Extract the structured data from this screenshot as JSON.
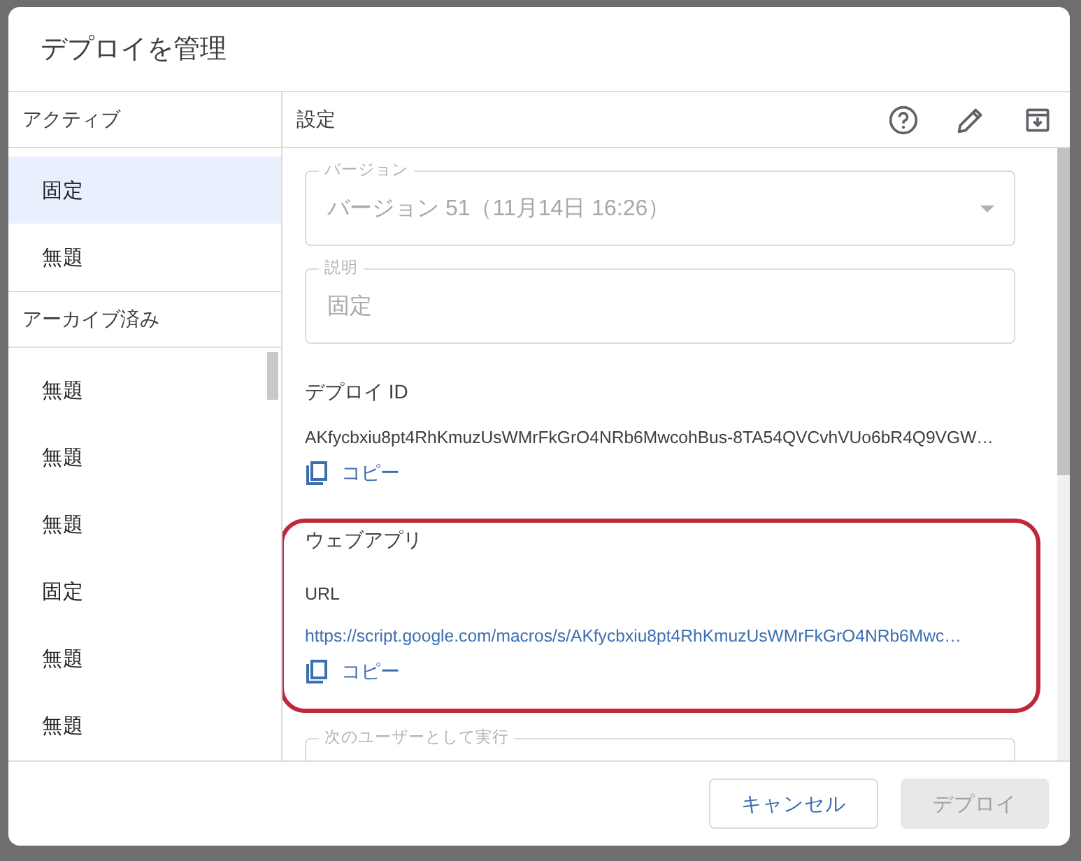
{
  "dialog": {
    "title": "デプロイを管理"
  },
  "sidebar": {
    "sections": [
      {
        "heading": "アクティブ",
        "items": [
          {
            "label": "固定",
            "selected": true
          },
          {
            "label": "無題",
            "selected": false
          }
        ]
      },
      {
        "heading": "アーカイブ済み",
        "items": [
          {
            "label": "無題",
            "selected": false
          },
          {
            "label": "無題",
            "selected": false
          },
          {
            "label": "無題",
            "selected": false
          },
          {
            "label": "固定",
            "selected": false
          },
          {
            "label": "無題",
            "selected": false
          },
          {
            "label": "無題",
            "selected": false
          }
        ]
      }
    ]
  },
  "settings": {
    "heading": "設定",
    "version": {
      "label": "バージョン",
      "value": "バージョン 51（11月14日 16:26）",
      "disabled": true
    },
    "description": {
      "label": "説明",
      "value": "固定",
      "disabled": true
    },
    "deploy_id": {
      "label": "デプロイ ID",
      "value": "AKfycbxiu8pt4RhKmuzUsWMrFkGrO4NRb6MwcohBus-8TA54QVCvhVUo6bR4Q9VGW…",
      "copy": "コピー"
    },
    "web_app": {
      "heading": "ウェブアプリ",
      "highlighted": true,
      "url_label": "URL",
      "url": "https://script.google.com/macros/s/AKfycbxiu8pt4RhKmuzUsWMrFkGrO4NRb6Mwc…",
      "copy": "コピー"
    },
    "run_as": {
      "label": "次のユーザーとして実行"
    }
  },
  "footer": {
    "buttons": [
      {
        "label": "キャンセル",
        "disabled": false
      },
      {
        "label": "デプロイ",
        "disabled": true
      }
    ]
  }
}
